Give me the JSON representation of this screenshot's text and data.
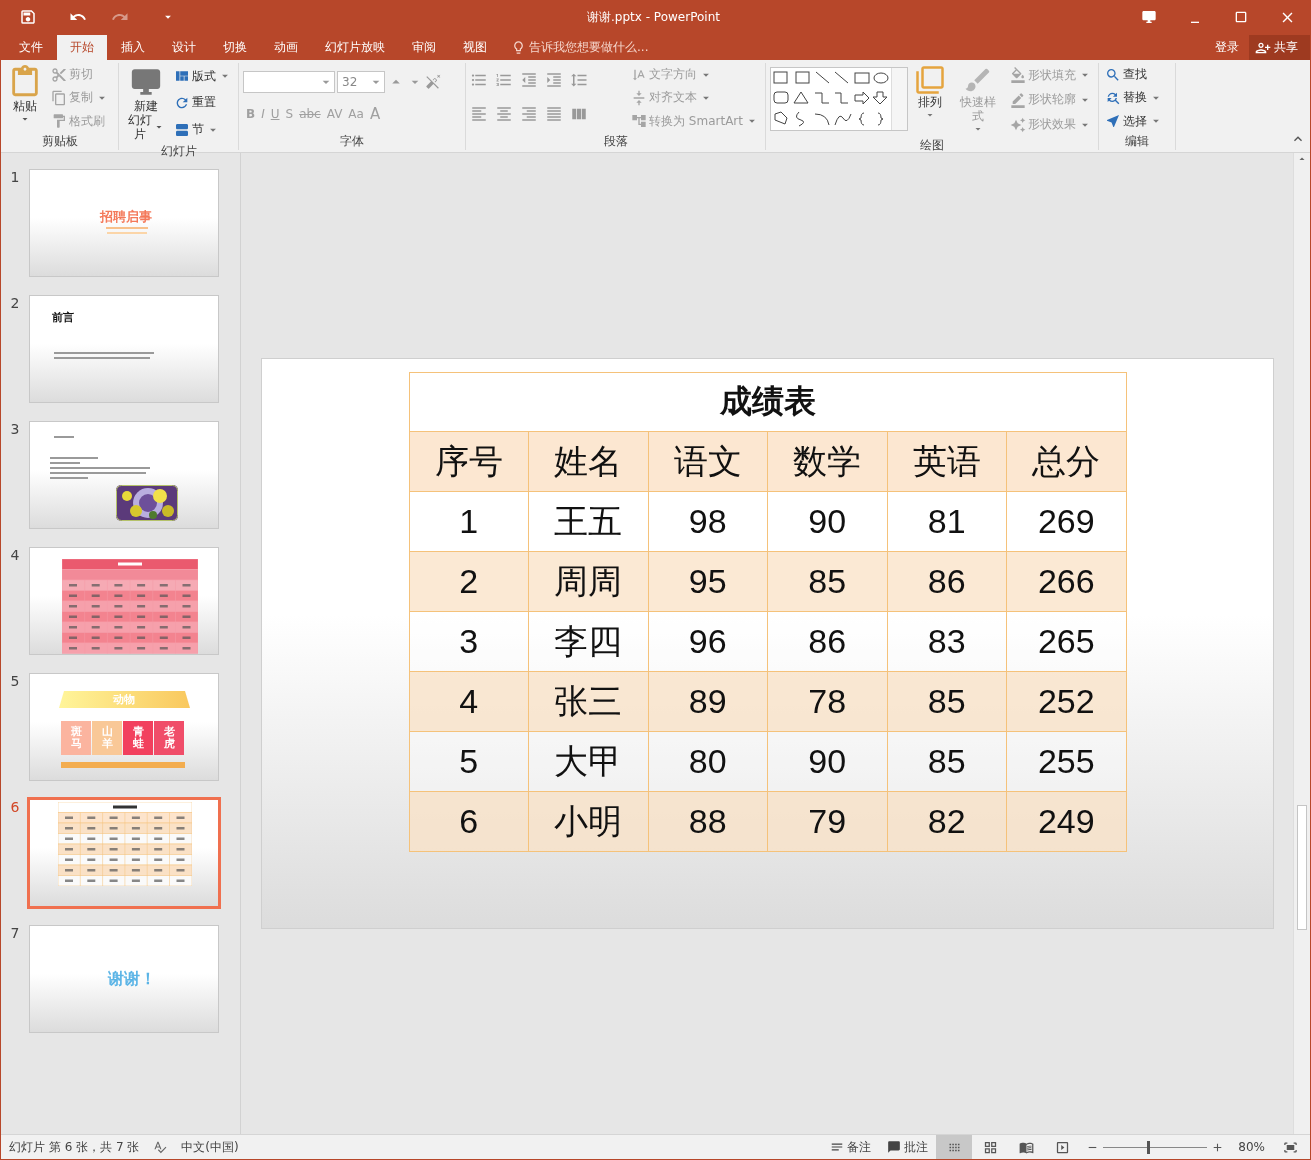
{
  "window": {
    "title": "谢谢.pptx - PowerPoint"
  },
  "tabs": [
    {
      "label": "文件",
      "selected": false
    },
    {
      "label": "开始",
      "selected": true
    },
    {
      "label": "插入",
      "selected": false
    },
    {
      "label": "设计",
      "selected": false
    },
    {
      "label": "切换",
      "selected": false
    },
    {
      "label": "动画",
      "selected": false
    },
    {
      "label": "幻灯片放映",
      "selected": false
    },
    {
      "label": "审阅",
      "selected": false
    },
    {
      "label": "视图",
      "selected": false
    }
  ],
  "tell_me": {
    "placeholder": "告诉我您想要做什么..."
  },
  "account": {
    "sign_in": "登录",
    "share": "共享"
  },
  "ribbon": {
    "groups": [
      {
        "kind": "clipboard",
        "label": "剪贴板",
        "large": {
          "lines": [
            "粘贴"
          ],
          "disabled": false
        },
        "small": [
          {
            "label": "剪切",
            "disabled": true
          },
          {
            "label": "复制",
            "disabled": true
          },
          {
            "label": "格式刷",
            "disabled": true
          }
        ]
      },
      {
        "kind": "slides",
        "label": "幻灯片",
        "large": {
          "lines": [
            "新建",
            "幻灯片"
          ],
          "disabled": false
        },
        "small": [
          {
            "label": "版式",
            "disabled": false
          },
          {
            "label": "重置",
            "disabled": false
          },
          {
            "label": "节",
            "disabled": false
          }
        ]
      },
      {
        "kind": "font",
        "label": "字体",
        "font_size": "32",
        "format": [
          {
            "label": "B",
            "disabled": true
          },
          {
            "label": "I",
            "disabled": true
          },
          {
            "label": "U",
            "disabled": true
          },
          {
            "label": "S",
            "disabled": true
          },
          {
            "label": "abc",
            "disabled": true
          },
          {
            "label": "AV",
            "disabled": true
          },
          {
            "label": "Aa",
            "disabled": true
          },
          {
            "label": "A",
            "disabled": true
          }
        ]
      },
      {
        "kind": "paragraph",
        "label": "段落",
        "small": [
          {
            "label": "文字方向",
            "disabled": true
          },
          {
            "label": "对齐文本",
            "disabled": true
          },
          {
            "label": "转换为 SmartArt",
            "disabled": true
          }
        ]
      },
      {
        "kind": "drawing",
        "label": "绘图",
        "large": [
          {
            "label": "排列",
            "disabled": false
          },
          {
            "label": "快速样式",
            "disabled": true
          }
        ],
        "small": [
          {
            "label": "形状填充",
            "disabled": true
          },
          {
            "label": "形状轮廓",
            "disabled": true
          },
          {
            "label": "形状效果",
            "disabled": true
          }
        ]
      },
      {
        "kind": "editing",
        "label": "编辑",
        "small": [
          {
            "label": "查找",
            "disabled": false
          },
          {
            "label": "替换",
            "disabled": false
          },
          {
            "label": "选择",
            "disabled": false
          }
        ]
      }
    ]
  },
  "slides": [
    {
      "number": "1",
      "selected": false,
      "kind": "title",
      "title": "招聘启事"
    },
    {
      "number": "2",
      "selected": false,
      "kind": "heading",
      "title": "前言"
    },
    {
      "number": "3",
      "selected": false,
      "kind": "text-picture"
    },
    {
      "number": "4",
      "selected": false,
      "kind": "red-table"
    },
    {
      "number": "5",
      "selected": false,
      "kind": "animals",
      "title": "动物",
      "cards": [
        {
          "label": "斑马",
          "color": "#fbb49f"
        },
        {
          "label": "山羊",
          "color": "#f9c897"
        },
        {
          "label": "青蛙",
          "color": "#f2405e"
        },
        {
          "label": "老虎",
          "color": "#f04d69"
        }
      ]
    },
    {
      "number": "6",
      "selected": true,
      "kind": "orange-table"
    },
    {
      "number": "7",
      "selected": false,
      "kind": "thanks",
      "title": "谢谢！"
    }
  ],
  "editor": {
    "kind": "orange-table",
    "table": {
      "title": "成绩表",
      "columns": [
        "序号",
        "姓名",
        "语文",
        "数学",
        "英语",
        "总分"
      ],
      "rows": [
        [
          "1",
          "王五",
          "98",
          "90",
          "81",
          "269"
        ],
        [
          "2",
          "周周",
          "95",
          "85",
          "86",
          "266"
        ],
        [
          "3",
          "李四",
          "96",
          "86",
          "83",
          "265"
        ],
        [
          "4",
          "张三",
          "89",
          "78",
          "85",
          "252"
        ],
        [
          "5",
          "大甲",
          "80",
          "90",
          "85",
          "255"
        ],
        [
          "6",
          "小明",
          "88",
          "79",
          "82",
          "249"
        ]
      ]
    }
  },
  "status_bar": {
    "slide_info": "幻灯片 第 6 张，共 7 张",
    "language": "中文(中国)",
    "notes": "备注",
    "comments": "批注",
    "views": [
      {
        "selected": true
      },
      {
        "selected": false
      },
      {
        "selected": false
      },
      {
        "selected": false
      }
    ],
    "zoom": {
      "level": 0.42,
      "reading": "80%"
    }
  }
}
